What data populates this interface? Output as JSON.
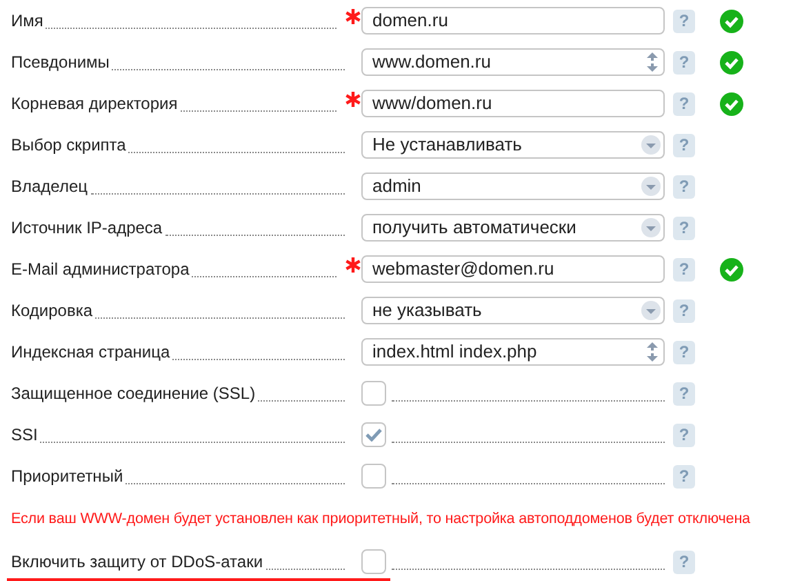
{
  "rows": [
    {
      "kind": "text",
      "label": "Имя",
      "required": true,
      "value": "domen.ru",
      "help": "?",
      "valid": true
    },
    {
      "kind": "spin",
      "label": "Псевдонимы",
      "required": false,
      "value": "www.domen.ru",
      "help": "?",
      "valid": true
    },
    {
      "kind": "text",
      "label": "Корневая директория",
      "required": true,
      "value": "www/domen.ru",
      "help": "?",
      "valid": true
    },
    {
      "kind": "select",
      "label": "Выбор скрипта",
      "required": false,
      "value": "Не устанавливать",
      "help": "?",
      "valid": false
    },
    {
      "kind": "select",
      "label": "Владелец",
      "required": false,
      "value": "admin",
      "help": "?",
      "valid": false
    },
    {
      "kind": "select",
      "label": "Источник IP-адреса",
      "required": false,
      "value": "получить автоматически",
      "help": "?",
      "valid": false
    },
    {
      "kind": "text",
      "label": "E-Mail администратора",
      "required": true,
      "value": "webmaster@domen.ru",
      "help": "?",
      "valid": true
    },
    {
      "kind": "select",
      "label": "Кодировка",
      "required": false,
      "value": "не указывать",
      "help": "?",
      "valid": false
    },
    {
      "kind": "spin",
      "label": "Индексная страница",
      "required": false,
      "value": "index.html index.php",
      "help": "?",
      "valid": false
    },
    {
      "kind": "checkbox",
      "label": "Защищенное соединение (SSL)",
      "required": false,
      "checked": false,
      "help": "?",
      "valid": false
    },
    {
      "kind": "checkbox",
      "label": "SSI",
      "required": false,
      "checked": true,
      "help": "?",
      "valid": false
    },
    {
      "kind": "checkbox",
      "label": "Приоритетный",
      "required": false,
      "checked": false,
      "help": "?",
      "valid": false
    }
  ],
  "notice": "Если ваш WWW-домен будет установлен как приоритетный, то настройка автоподдоменов будет отключена",
  "ddos_row": {
    "kind": "checkbox",
    "label": "Включить защиту от DDoS-атаки",
    "required": false,
    "checked": false,
    "help": "?",
    "valid": false,
    "underlined": true
  }
}
